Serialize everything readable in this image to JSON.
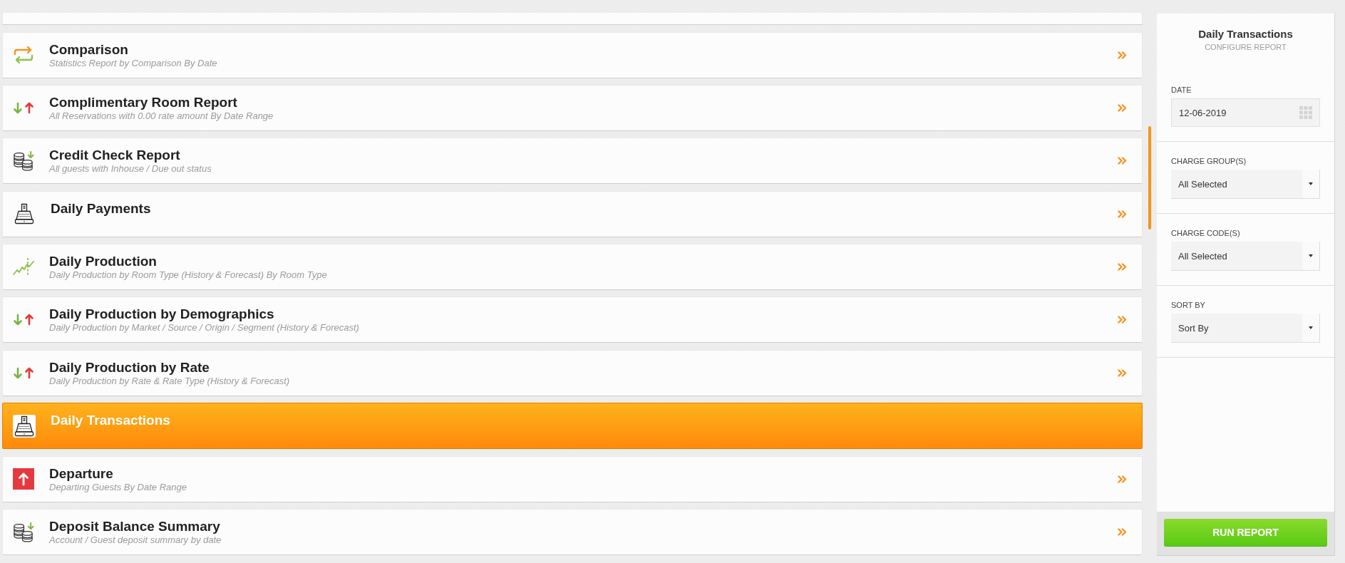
{
  "reports": [
    {
      "kind": "swap",
      "title": "Comparison",
      "subtitle": "Statistics Report by Comparison By Date",
      "selected": false
    },
    {
      "kind": "updown",
      "title": "Complimentary Room Report",
      "subtitle": "All Reservations with 0.00 rate amount By Date Range",
      "selected": false
    },
    {
      "kind": "coins",
      "title": "Credit Check Report",
      "subtitle": "All guests with Inhouse / Due out status",
      "selected": false
    },
    {
      "kind": "register",
      "title": "Daily Payments",
      "selected": false
    },
    {
      "kind": "chart",
      "title": "Daily Production",
      "subtitle": "Daily Production by Room Type (History & Forecast) By Room Type",
      "selected": false
    },
    {
      "kind": "updown",
      "title": "Daily Production by Demographics",
      "subtitle": "Daily Production by Market / Source / Origin / Segment (History & Forecast)",
      "selected": false
    },
    {
      "kind": "updown",
      "title": "Daily Production by Rate",
      "subtitle": "Daily Production by Rate & Rate Type (History & Forecast)",
      "selected": false
    },
    {
      "kind": "register",
      "title": "Daily Transactions",
      "selected": true
    },
    {
      "kind": "departure",
      "title": "Departure",
      "subtitle": "Departing Guests By Date Range",
      "selected": false
    },
    {
      "kind": "coins",
      "title": "Deposit Balance Summary",
      "subtitle": "Account / Guest deposit summary by date",
      "selected": false
    }
  ],
  "config_panel": {
    "title": "Daily Transactions",
    "subtitle": "CONFIGURE REPORT",
    "fields": [
      {
        "kind": "date",
        "label": "DATE",
        "value": "12-06-2019"
      },
      {
        "kind": "select",
        "label": "CHARGE GROUP(S)",
        "value": "All Selected"
      },
      {
        "kind": "select",
        "label": "CHARGE CODE(S)",
        "value": "All Selected"
      },
      {
        "kind": "select",
        "label": "SORT BY",
        "value": "Sort By"
      }
    ],
    "button": "RUN REPORT"
  }
}
